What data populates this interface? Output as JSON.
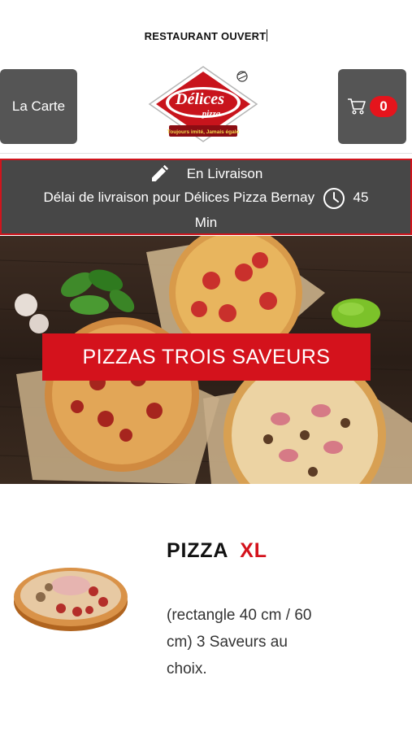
{
  "status": {
    "text": "RESTAURANT OUVERT"
  },
  "header": {
    "menu_label": "La Carte",
    "cart_count": "0",
    "logo": {
      "name": "Délices",
      "sub": "pizza",
      "tagline": "Toujours imité, Jamais égalé"
    }
  },
  "delivery": {
    "mode": "En Livraison",
    "delay_text": "Délai de livraison pour Délices Pizza Bernay",
    "delay_value": "45",
    "delay_unit": "Min"
  },
  "hero": {
    "banner": "PIZZAS TROIS SAVEURS"
  },
  "product": {
    "name": "PIZZA",
    "size": "XL",
    "description": "(rectangle 40 cm / 60 cm)  3 Saveurs au choix."
  },
  "colors": {
    "accent": "#d4121c",
    "button_bg": "#555555",
    "delivery_bg": "#474747"
  },
  "icons": {
    "cart": "cart-icon",
    "edit": "pencil-icon",
    "clock": "clock-icon"
  }
}
